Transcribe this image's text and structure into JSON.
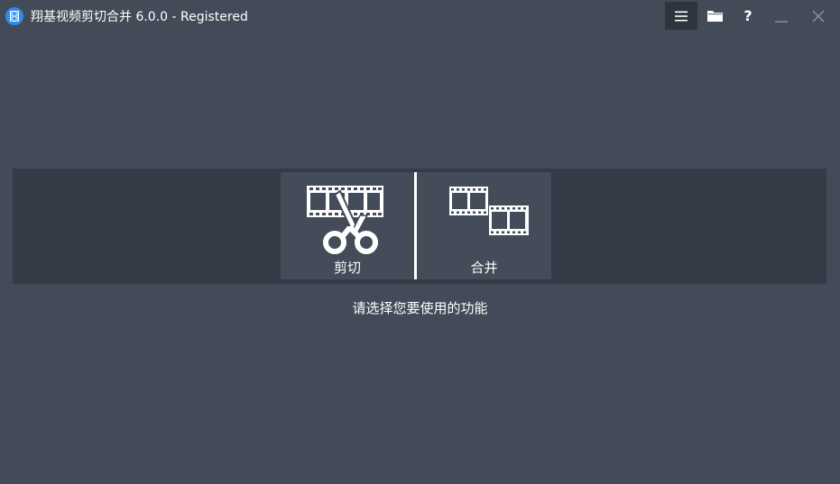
{
  "window": {
    "title": "翔基视频剪切合并 6.0.0 - Registered",
    "icon": "film-app-icon"
  },
  "toolbar": {
    "menu_icon": "hamburger-menu-icon",
    "folder_icon": "folder-icon",
    "help_label": "?",
    "minimize_icon": "minimize-icon",
    "close_icon": "close-icon"
  },
  "functions": [
    {
      "label": "剪切",
      "icon": "film-scissors-icon"
    },
    {
      "label": "合并",
      "icon": "film-merge-icon"
    }
  ],
  "prompt": "请选择您要使用的功能",
  "colors": {
    "background": "#424b57",
    "band": "#343b46",
    "tile": "#434c58",
    "active_button": "#2e353f",
    "accent": "#2d8cf0",
    "text": "#ffffff"
  }
}
